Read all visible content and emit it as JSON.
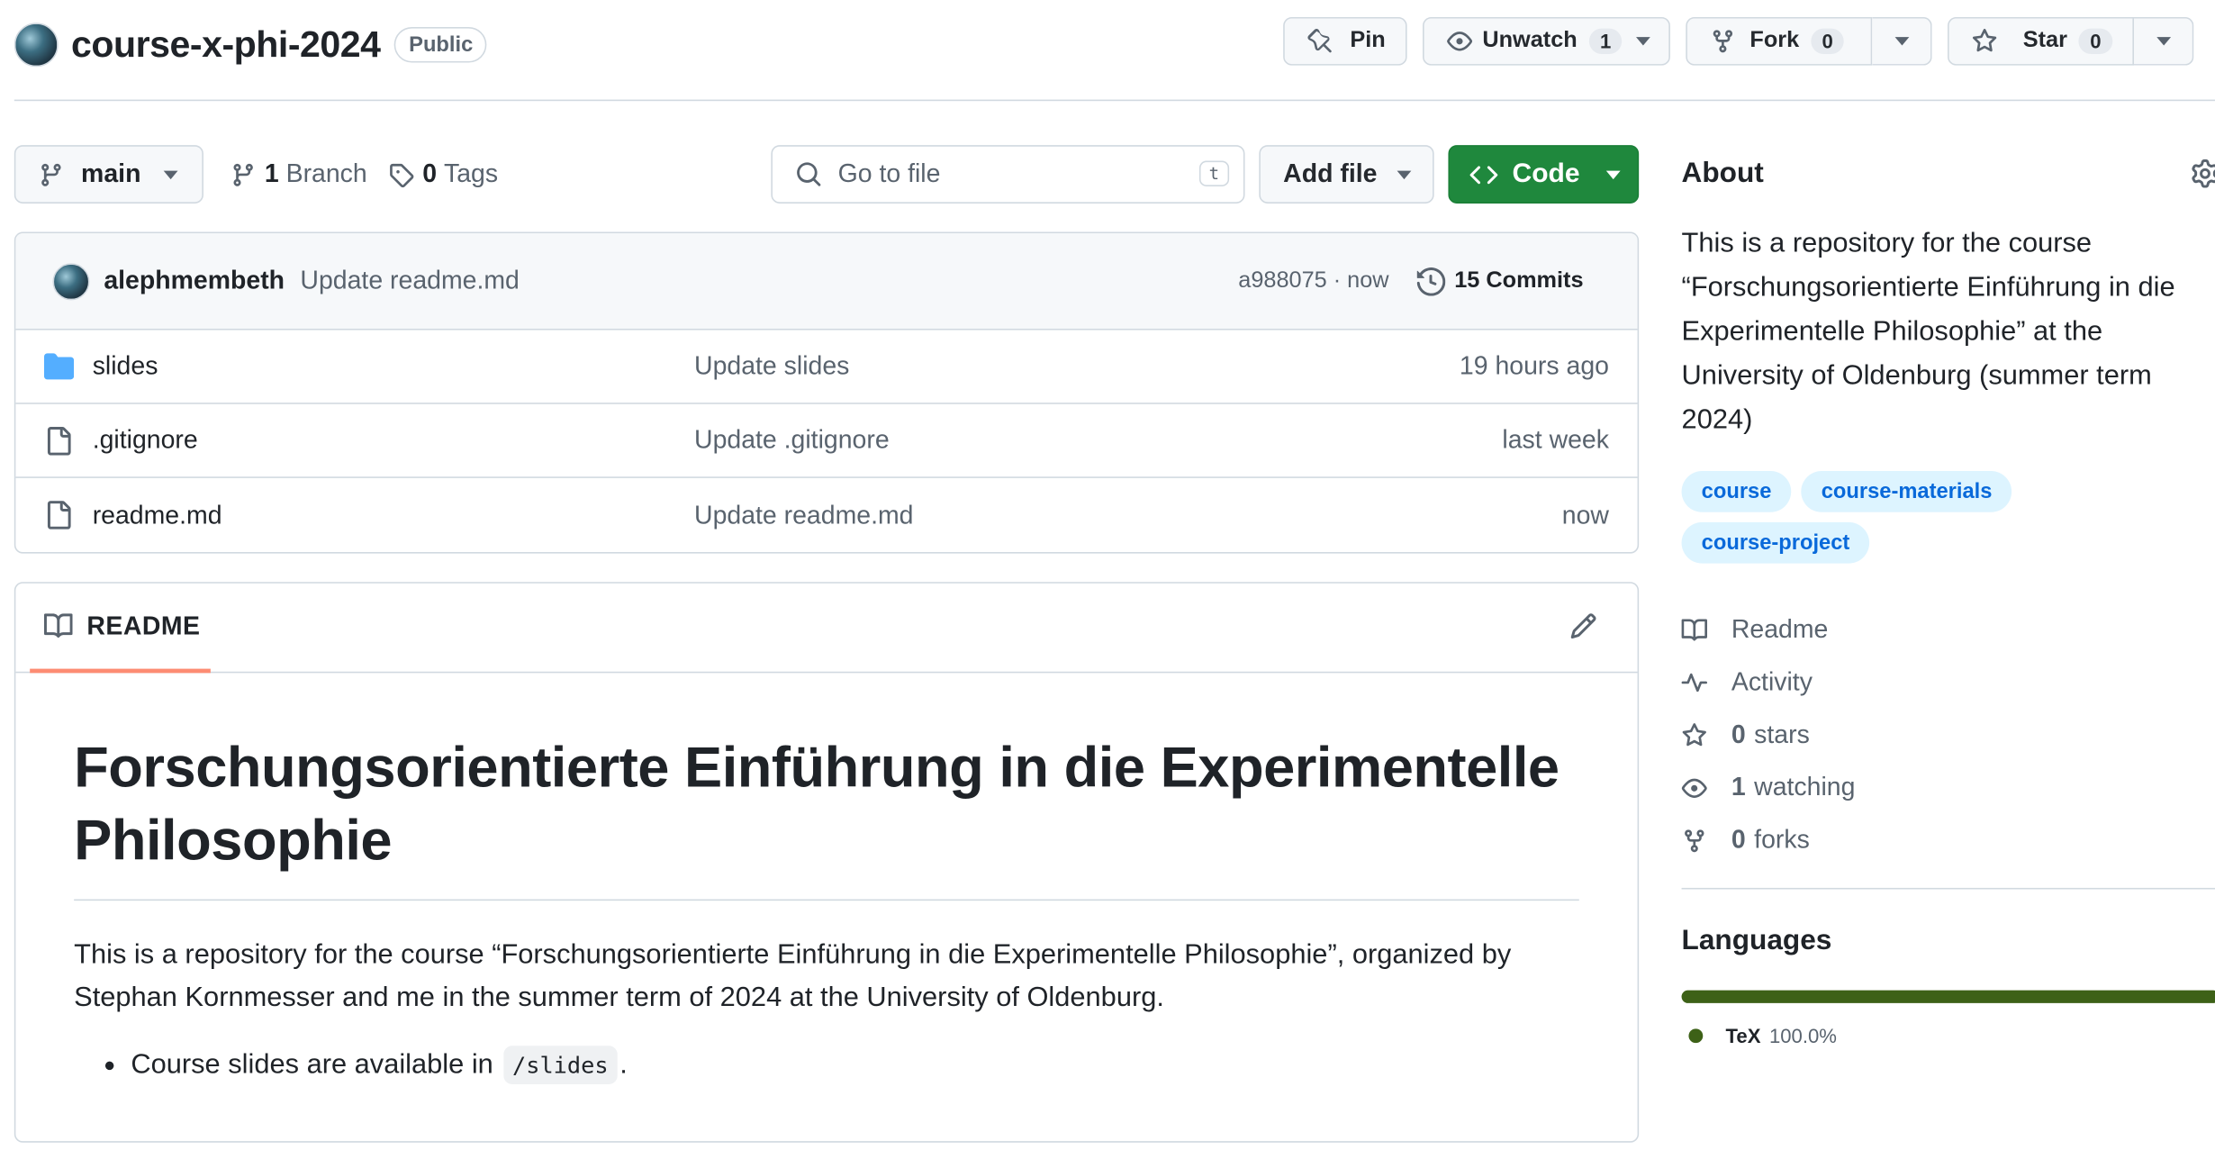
{
  "repo": {
    "name": "course-x-phi-2024",
    "visibility": "Public"
  },
  "actions": {
    "pin_label": "Pin",
    "unwatch_label": "Unwatch",
    "watch_count": "1",
    "fork_label": "Fork",
    "fork_count": "0",
    "star_label": "Star",
    "star_count": "0"
  },
  "toolbar": {
    "branch": "main",
    "branch_count": "1",
    "branch_label": "Branch",
    "tag_count": "0",
    "tag_label": "Tags",
    "search_placeholder": "Go to file",
    "search_shortcut": "t",
    "add_file_label": "Add file",
    "code_label": "Code"
  },
  "latest_commit": {
    "author": "alephmembeth",
    "message": "Update readme.md",
    "sha_time": "a988075 · now",
    "commits_label": "15 Commits"
  },
  "files": [
    {
      "icon": "folder-icon",
      "name": "slides",
      "message": "Update slides",
      "time": "19 hours ago"
    },
    {
      "icon": "file-icon",
      "name": ".gitignore",
      "message": "Update .gitignore",
      "time": "last week"
    },
    {
      "icon": "file-icon",
      "name": "readme.md",
      "message": "Update readme.md",
      "time": "now"
    }
  ],
  "readme": {
    "tab_label": "README",
    "title": "Forschungsorientierte Einführung in die Experimentelle Philosophie",
    "paragraph": "This is a repository for the course “Forschungsorientierte Einführung in die Experimentelle Philosophie”, organized by Stephan Kornmesser and me in the summer term of 2024 at the University of Oldenburg.",
    "bullet_prefix": "Course slides are available in",
    "bullet_code": "/slides",
    "bullet_suffix": "."
  },
  "about": {
    "heading": "About",
    "description": "This is a repository for the course “Forschungsorientierte Einführung in die Experimentelle Philosophie” at the University of Oldenburg (summer term 2024)",
    "topics": [
      "course",
      "course-materials",
      "course-project"
    ],
    "links": [
      {
        "icon": "book-icon",
        "count": "",
        "label": "Readme"
      },
      {
        "icon": "pulse-icon",
        "count": "",
        "label": "Activity"
      },
      {
        "icon": "star-icon",
        "count": "0",
        "label": "stars"
      },
      {
        "icon": "eye-icon",
        "count": "1",
        "label": "watching"
      },
      {
        "icon": "fork-icon",
        "count": "0",
        "label": "forks"
      }
    ]
  },
  "languages": {
    "heading": "Languages",
    "items": [
      {
        "name": "TeX",
        "percent": "100.0%",
        "color": "#3d6117"
      }
    ]
  },
  "colors": {
    "accent_green": "#1f883d",
    "topic_bg": "#ddf4ff",
    "topic_fg": "#0969da",
    "tab_underline": "#fd8c73"
  }
}
